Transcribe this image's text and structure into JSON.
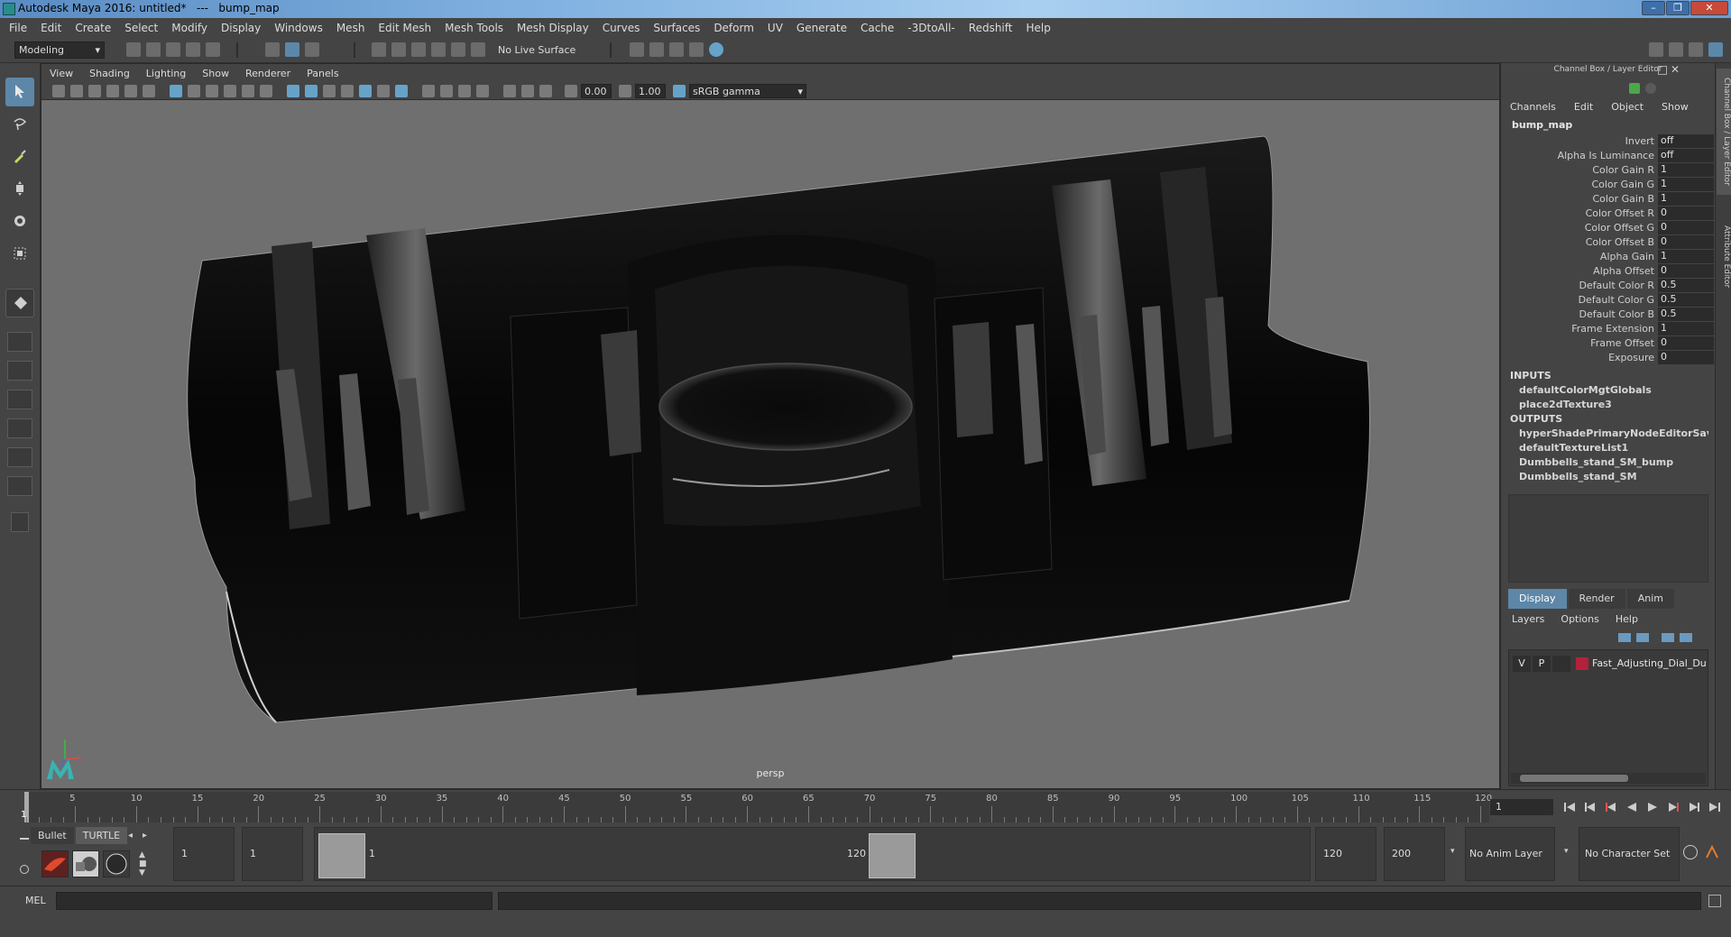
{
  "window": {
    "title": "Autodesk Maya 2016: untitled*   ---   bump_map",
    "controls": [
      "–",
      "❐",
      "✕"
    ]
  },
  "menubar": [
    "File",
    "Edit",
    "Create",
    "Select",
    "Modify",
    "Display",
    "Windows",
    "Mesh",
    "Edit Mesh",
    "Mesh Tools",
    "Mesh Display",
    "Curves",
    "Surfaces",
    "Deform",
    "UV",
    "Generate",
    "Cache",
    "-3DtoAll-",
    "Redshift",
    "Help"
  ],
  "toolbar": {
    "mode": "Modeling",
    "live_surface": "No Live Surface"
  },
  "viewport": {
    "menu": [
      "View",
      "Shading",
      "Lighting",
      "Show",
      "Renderer",
      "Panels"
    ],
    "exposure": "0.00",
    "gamma": "1.00",
    "color_space": "sRGB gamma",
    "camera": "persp"
  },
  "channel_box": {
    "title": "Channel Box / Layer Editor",
    "menu": [
      "Channels",
      "Edit",
      "Object",
      "Show"
    ],
    "node": "bump_map",
    "attributes": [
      {
        "label": "Invert",
        "value": "off"
      },
      {
        "label": "Alpha Is Luminance",
        "value": "off"
      },
      {
        "label": "Color Gain R",
        "value": "1"
      },
      {
        "label": "Color Gain G",
        "value": "1"
      },
      {
        "label": "Color Gain B",
        "value": "1"
      },
      {
        "label": "Color Offset R",
        "value": "0"
      },
      {
        "label": "Color Offset G",
        "value": "0"
      },
      {
        "label": "Color Offset B",
        "value": "0"
      },
      {
        "label": "Alpha Gain",
        "value": "1"
      },
      {
        "label": "Alpha Offset",
        "value": "0"
      },
      {
        "label": "Default Color R",
        "value": "0.5"
      },
      {
        "label": "Default Color G",
        "value": "0.5"
      },
      {
        "label": "Default Color B",
        "value": "0.5"
      },
      {
        "label": "Frame Extension",
        "value": "1"
      },
      {
        "label": "Frame Offset",
        "value": "0"
      },
      {
        "label": "Exposure",
        "value": "0"
      }
    ],
    "inputs_label": "INPUTS",
    "inputs": [
      "defaultColorMgtGlobals",
      "place2dTexture3"
    ],
    "outputs_label": "OUTPUTS",
    "outputs": [
      "hyperShadePrimaryNodeEditorSavedT...",
      "defaultTextureList1",
      "Dumbbells_stand_SM_bump",
      "Dumbbells_stand_SM"
    ]
  },
  "layer_editor": {
    "tabs": [
      "Display",
      "Render",
      "Anim"
    ],
    "active_tab": "Display",
    "menu": [
      "Layers",
      "Options",
      "Help"
    ],
    "layers": [
      {
        "visible": "V",
        "playback": "P",
        "name": "Fast_Adjusting_Dial_Dur",
        "color": "#b3213a"
      }
    ]
  },
  "side_tabs": [
    "Channel Box / Layer Editor",
    "Attribute Editor"
  ],
  "time_slider": {
    "start": "1",
    "ticks": [
      "5",
      "10",
      "15",
      "20",
      "25",
      "30",
      "35",
      "40",
      "45",
      "50",
      "55",
      "60",
      "65",
      "70",
      "75",
      "80",
      "85",
      "90",
      "95",
      "100",
      "105",
      "110",
      "115",
      "120"
    ],
    "current_frame": "1"
  },
  "range_slider": {
    "shelf_tabs": [
      "Bullet",
      "TURTLE"
    ],
    "anim_start": "1",
    "range_start": "1",
    "range_handle_start": "1",
    "range_handle_end": "120",
    "range_end": "120",
    "anim_end": "200",
    "anim_layer": "No Anim Layer",
    "character_set": "No Character Set"
  },
  "command_line": {
    "label": "MEL"
  },
  "colors": {
    "accent": "#5d87a8",
    "ui_bg": "#444444",
    "viewport_bg": "#6f6f6f"
  }
}
